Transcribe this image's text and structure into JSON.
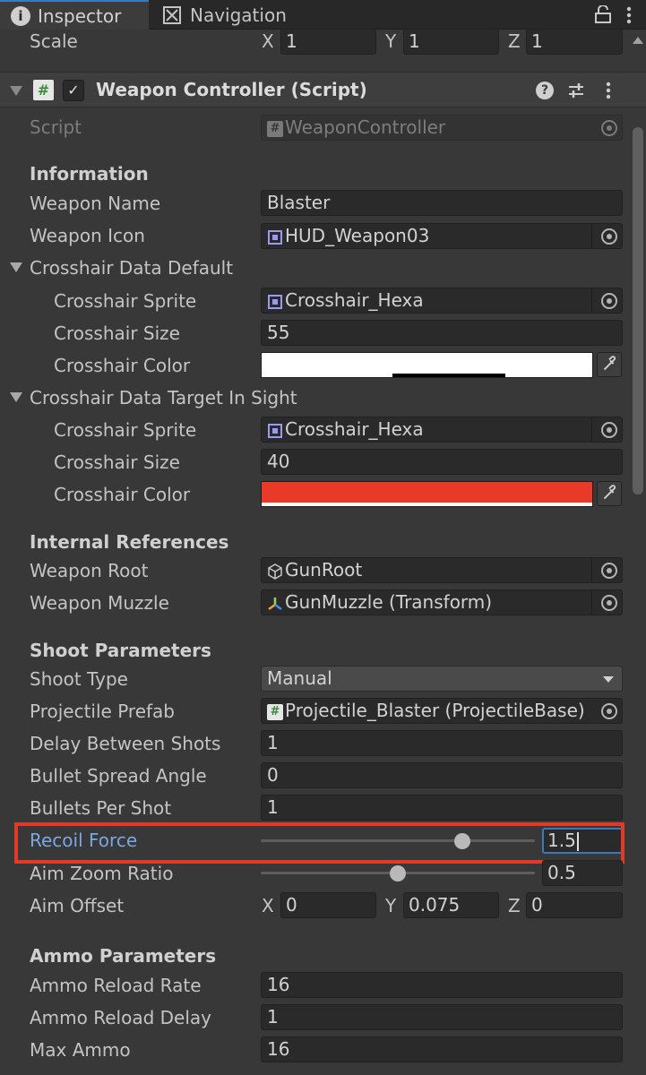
{
  "tabs": {
    "inspector": "Inspector",
    "navigation": "Navigation"
  },
  "scale_row": {
    "label": "Scale",
    "x_label": "X",
    "x": "1",
    "y_label": "Y",
    "y": "1",
    "z_label": "Z",
    "z": "1"
  },
  "component": {
    "title": "Weapon Controller (Script)",
    "enabled": true,
    "script_label": "Script",
    "script_value": "WeaponController"
  },
  "information": {
    "header": "Information",
    "weapon_name_label": "Weapon Name",
    "weapon_name": "Blaster",
    "weapon_icon_label": "Weapon Icon",
    "weapon_icon": "HUD_Weapon03"
  },
  "crosshair_default": {
    "header": "Crosshair Data Default",
    "sprite_label": "Crosshair Sprite",
    "sprite": "Crosshair_Hexa",
    "size_label": "Crosshair Size",
    "size": "55",
    "color_label": "Crosshair Color",
    "color": "#ffffff",
    "alpha": 0.66
  },
  "crosshair_target": {
    "header": "Crosshair Data Target In Sight",
    "sprite_label": "Crosshair Sprite",
    "sprite": "Crosshair_Hexa",
    "size_label": "Crosshair Size",
    "size": "40",
    "color_label": "Crosshair Color",
    "color": "#e83a26",
    "alpha": 1.0
  },
  "internal_refs": {
    "header": "Internal References",
    "root_label": "Weapon Root",
    "root": "GunRoot",
    "muzzle_label": "Weapon Muzzle",
    "muzzle": "GunMuzzle (Transform)"
  },
  "shoot": {
    "header": "Shoot Parameters",
    "type_label": "Shoot Type",
    "type": "Manual",
    "prefab_label": "Projectile Prefab",
    "prefab": "Projectile_Blaster (ProjectileBase)",
    "delay_label": "Delay Between Shots",
    "delay": "1",
    "spread_label": "Bullet Spread Angle",
    "spread": "0",
    "per_shot_label": "Bullets Per Shot",
    "per_shot": "1",
    "recoil_label": "Recoil Force",
    "recoil": "1.5",
    "recoil_fraction": 0.75,
    "aim_zoom_label": "Aim Zoom Ratio",
    "aim_zoom": "0.5",
    "aim_zoom_fraction": 0.5,
    "aim_offset_label": "Aim Offset",
    "aim_offset_x_label": "X",
    "aim_offset_x": "0",
    "aim_offset_y_label": "Y",
    "aim_offset_y": "0.075",
    "aim_offset_z_label": "Z",
    "aim_offset_z": "0"
  },
  "ammo": {
    "header": "Ammo Parameters",
    "reload_rate_label": "Ammo Reload Rate",
    "reload_rate": "16",
    "reload_delay_label": "Ammo Reload Delay",
    "reload_delay": "1",
    "max_label": "Max Ammo",
    "max": "16"
  },
  "colors": {
    "accent": "#3a79bb",
    "highlight": "#e23a27",
    "focused_label": "#7ba7e0"
  }
}
